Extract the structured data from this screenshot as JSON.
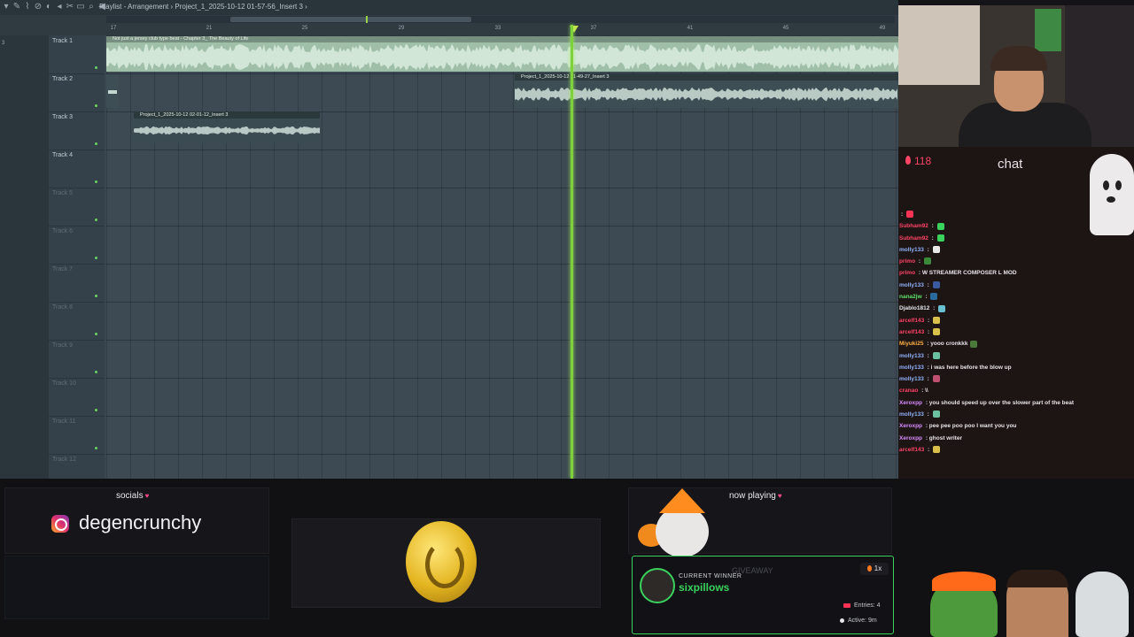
{
  "daw": {
    "toolbar_title": "Playlist - Arrangement › Project_1_2025-10-12 01-57-56_Insert 3 ›",
    "left_mark": "3",
    "ruler": [
      "17",
      "21",
      "25",
      "29",
      "33",
      "37",
      "41",
      "45",
      "49"
    ],
    "tracks": [
      {
        "name": "Track 1",
        "dim": false
      },
      {
        "name": "Track 2",
        "dim": false
      },
      {
        "name": "Track 3",
        "dim": false
      },
      {
        "name": "Track 4",
        "dim": false
      },
      {
        "name": "Track 5",
        "dim": true
      },
      {
        "name": "Track 6",
        "dim": true
      },
      {
        "name": "Track 7",
        "dim": true
      },
      {
        "name": "Track 8",
        "dim": true
      },
      {
        "name": "Track 9",
        "dim": true
      },
      {
        "name": "Track 10",
        "dim": true
      },
      {
        "name": "Track 11",
        "dim": true
      },
      {
        "name": "Track 12",
        "dim": true
      }
    ],
    "clips": {
      "clip1_title": "Not just a jersey club type beat - Chapter 3_ The Beauty of Life",
      "clip2_title": "Project_1_2025-10-12 01-49-27_Insert 3",
      "clip3_title": "Project_1_2025-10-12 02-01-12_Insert 3"
    }
  },
  "stream": {
    "viewer_count": "118",
    "chat_title": "chat",
    "chat": [
      {
        "user": "",
        "msg": "",
        "color": "#ff4466",
        "emote": "#ff3355"
      },
      {
        "user": "Subham92",
        "msg": "",
        "color": "#ff4466",
        "emote": "#3ad15c"
      },
      {
        "user": "Subham92",
        "msg": "",
        "color": "#ff4466",
        "emote": "#3ad15c"
      },
      {
        "user": "molly133",
        "msg": "",
        "color": "#8fb4ff",
        "emote": "#e8e8e8"
      },
      {
        "user": "primo",
        "msg": "",
        "color": "#ff4466",
        "emote": "#3a8a3a"
      },
      {
        "user": "primo",
        "msg": "W STREAMER COMPOSER L MOD",
        "color": "#ff4466",
        "emote": ""
      },
      {
        "user": "molly133",
        "msg": "",
        "color": "#8fb4ff",
        "emote": "#3a5aa0"
      },
      {
        "user": "nana2jw",
        "msg": "",
        "color": "#5fe06a",
        "emote": "#2a6a9a"
      },
      {
        "user": "Djablo1812",
        "msg": "",
        "color": "#e8e8ee",
        "emote": "#6ac0d0"
      },
      {
        "user": "arcelf143",
        "msg": "",
        "color": "#ff4466",
        "emote": "#d8c04a"
      },
      {
        "user": "arcelf143",
        "msg": "",
        "color": "#ff4466",
        "emote": "#d8c04a"
      },
      {
        "user": "Miyuki25",
        "msg": "yooo cronkkk",
        "color": "#ffb040",
        "emote": "#4a7a3a"
      },
      {
        "user": "molly133",
        "msg": "",
        "color": "#8fb4ff",
        "emote": "#6ac0a0"
      },
      {
        "user": "molly133",
        "msg": "i was here before the blow up",
        "color": "#8fb4ff",
        "emote": ""
      },
      {
        "user": "molly133",
        "msg": "",
        "color": "#8fb4ff",
        "emote": "#c05070"
      },
      {
        "user": "cranao",
        "msg": "\\\\",
        "color": "#ff4466",
        "emote": ""
      },
      {
        "user": "Xeroxpp",
        "msg": "you should speed up over the slower part of the beat",
        "color": "#d88cff",
        "emote": ""
      },
      {
        "user": "molly133",
        "msg": "",
        "color": "#8fb4ff",
        "emote": "#6ac0a0"
      },
      {
        "user": "Xeroxpp",
        "msg": "pee pee poo poo I want you you",
        "color": "#d88cff",
        "emote": ""
      },
      {
        "user": "Xeroxpp",
        "msg": "ghost writer",
        "color": "#d88cff",
        "emote": ""
      },
      {
        "user": "arcelf143",
        "msg": "",
        "color": "#ff4466",
        "emote": "#d8c04a"
      }
    ]
  },
  "overlay": {
    "socials_label": "socials",
    "social_handle": "degencrunchy",
    "now_playing_label": "now playing",
    "giveaway_label": "GIVEAWAY",
    "winner_caption": "CURRENT WINNER",
    "winner_name": "sixpillows",
    "multiplier": "1x",
    "entries": "Entries: 4",
    "active": "Active: 9m"
  }
}
